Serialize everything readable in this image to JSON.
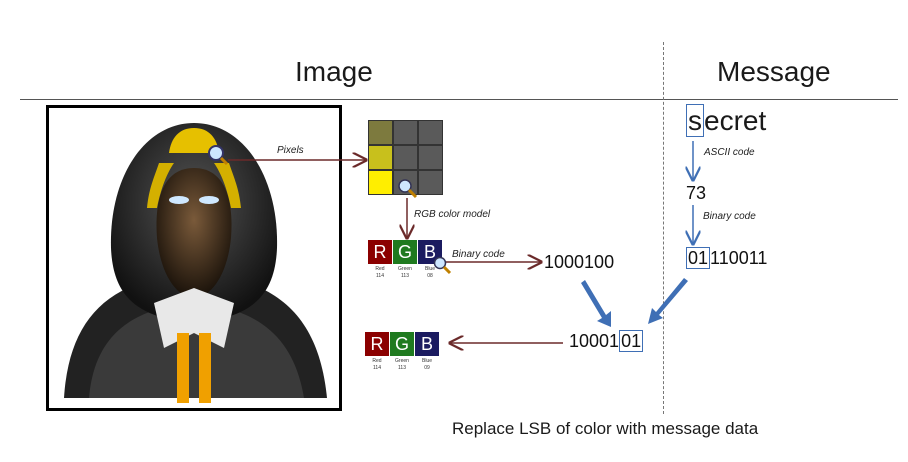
{
  "header": {
    "left": "Image",
    "right": "Message"
  },
  "arrows": {
    "pixels": "Pixels",
    "rgb_model": "RGB color model",
    "binary_left": "Binary code",
    "ascii": "ASCII code",
    "binary_right": "Binary code"
  },
  "rgb_top": {
    "letters": [
      "R",
      "G",
      "B"
    ],
    "names": [
      "Red",
      "Green",
      "Blue"
    ],
    "values": [
      "114",
      "113",
      "08"
    ]
  },
  "rgb_bottom": {
    "letters": [
      "R",
      "G",
      "B"
    ],
    "names": [
      "Red",
      "Green",
      "Blue"
    ],
    "values": [
      "114",
      "113",
      "09"
    ]
  },
  "message": {
    "first_letter": "s",
    "rest": "ecret",
    "ascii_value": "73",
    "binary_boxed": "01",
    "binary_rest": "110011"
  },
  "pixel_binary": "1000100",
  "result": {
    "prefix": "10001",
    "boxed": "01"
  },
  "caption": "Replace LSB of color with message data",
  "colors": {
    "red": "#8b0000",
    "green": "#1f7a1f",
    "blue": "#1b1b60",
    "arrow_dark": "#6b2a2a",
    "arrow_blue": "#3f6fb5"
  }
}
